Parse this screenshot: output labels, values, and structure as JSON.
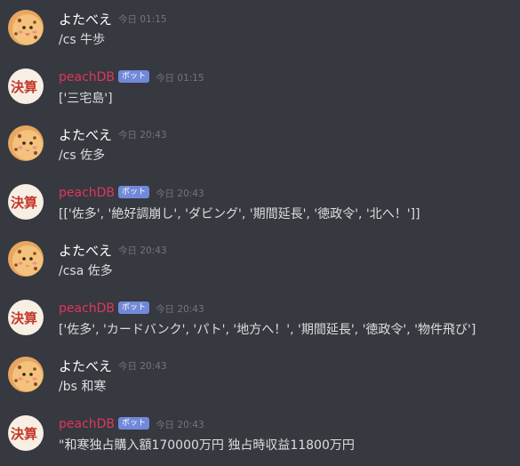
{
  "messages": [
    {
      "author": "よたべえ",
      "bot": false,
      "bot_tag": "",
      "time": "今日 01:15",
      "text": "/cs 牛歩"
    },
    {
      "author": "peachDB",
      "bot": true,
      "bot_tag": "ボット",
      "time": "今日 01:15",
      "text": "['三宅島']"
    },
    {
      "author": "よたべえ",
      "bot": false,
      "bot_tag": "",
      "time": "今日 20:43",
      "text": "/cs 佐多"
    },
    {
      "author": "peachDB",
      "bot": true,
      "bot_tag": "ボット",
      "time": "今日 20:43",
      "text": "[['佐多', '絶好調崩し', 'ダビング', '期間延長', '徳政令', '北へ！']]"
    },
    {
      "author": "よたべえ",
      "bot": false,
      "bot_tag": "",
      "time": "今日 20:43",
      "text": "/csa 佐多"
    },
    {
      "author": "peachDB",
      "bot": true,
      "bot_tag": "ボット",
      "time": "今日 20:43",
      "text": "['佐多', 'カードバンク', 'パト', '地方へ！', '期間延長', '徳政令', '物件飛び']"
    },
    {
      "author": "よたべえ",
      "bot": false,
      "bot_tag": "",
      "time": "今日 20:43",
      "text": "/bs 和寒"
    },
    {
      "author": "peachDB",
      "bot": true,
      "bot_tag": "ボット",
      "time": "今日 20:43",
      "text": "\"和寒独占購入額170000万円 独占時収益11800万円"
    }
  ],
  "avatars": {
    "user": {
      "icon": "cookie-character-icon",
      "bg": "#f1b266"
    },
    "bot": {
      "icon": "kessan-badge-icon",
      "text": "決算",
      "bg": "#f7efe4",
      "color": "#c4392b"
    }
  },
  "colors": {
    "background": "#36393f",
    "username": "#ffffff",
    "bot_username": "#e0365c",
    "bot_tag": "#7289da",
    "timestamp": "#72767d",
    "text": "#dcddde"
  }
}
